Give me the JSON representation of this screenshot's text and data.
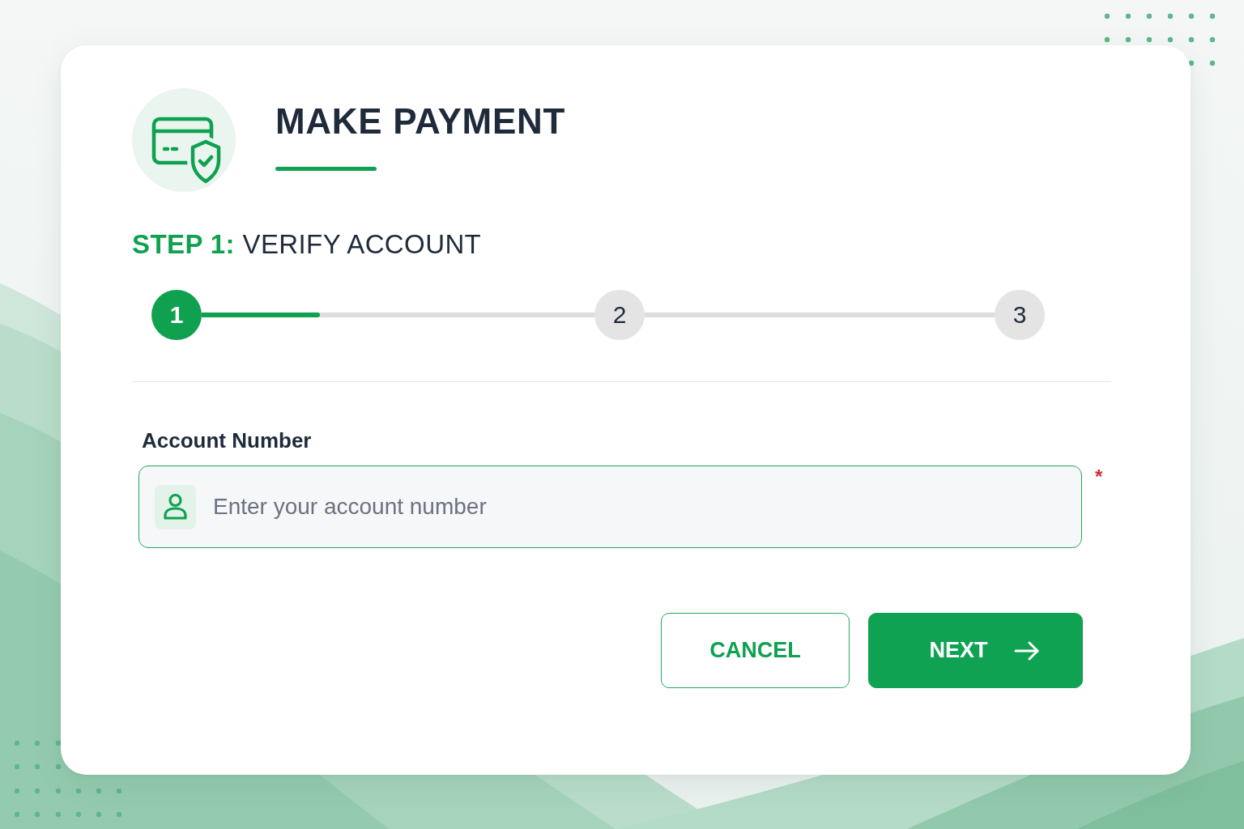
{
  "header": {
    "title": "MAKE PAYMENT"
  },
  "step_heading": "**STEP 1:** VERIFY ACCOUNT",
  "stepper": {
    "level": 0.3,
    "steps": [
      {
        "label": "1",
        "selected": true
      },
      {
        "label": "2",
        "selected": false
      },
      {
        "label": "3",
        "selected": false
      }
    ]
  },
  "form": {
    "fields": [
      {
        "label": "Account Number",
        "placeholder": "Enter your account number",
        "required_mark": "*"
      }
    ]
  },
  "buttons": [
    {
      "label": "CANCEL",
      "kind": "secondary"
    },
    {
      "label": "NEXT",
      "kind": "primary"
    }
  ]
}
